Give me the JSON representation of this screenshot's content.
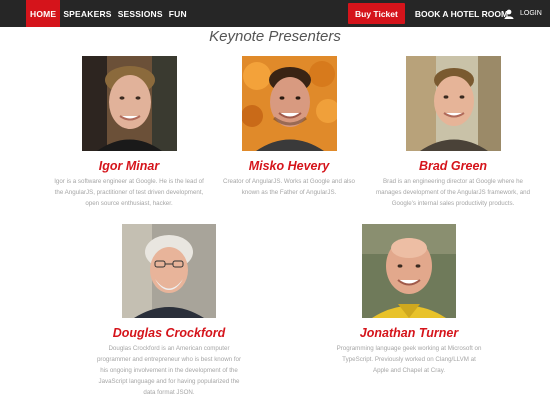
{
  "nav": {
    "home": "HOME",
    "speakers": "SPEAKERS",
    "sessions": "SESSIONS",
    "fun": "FUN",
    "buy_ticket": "Buy Ticket",
    "hotel": "BOOK A HOTEL ROOM",
    "login": "LOGIN",
    "login_icon": "user-icon"
  },
  "section_title": "Keynote Presenters",
  "speakers": [
    {
      "name": "Igor Minar",
      "bio": "Igor is a software engineer at Google. He is the lead of the AngularJS, practitioner of test driven development, open source enthusiast, hacker."
    },
    {
      "name": "Misko Hevery",
      "bio": "Creator of AngularJS. Works at Google and also known as the Father of AngularJS."
    },
    {
      "name": "Brad Green",
      "bio": "Brad is an engineering director at Google where he manages development of the AngularJS framework, and Google's internal sales productivity products."
    },
    {
      "name": "Douglas Crockford",
      "bio": "Douglas Crockford is an American computer programmer and entrepreneur who is best known for his ongoing involvement in the development of the JavaScript language and for having popularized the data format JSON."
    },
    {
      "name": "Jonathan Turner",
      "bio": "Programming language geek working at Microsoft on TypeScript. Previously worked on Clang/LLVM at Apple and Chapel at Cray."
    }
  ],
  "colors": {
    "accent": "#d5141b",
    "navbar": "#262626",
    "bio_text": "#a6a6a6"
  }
}
